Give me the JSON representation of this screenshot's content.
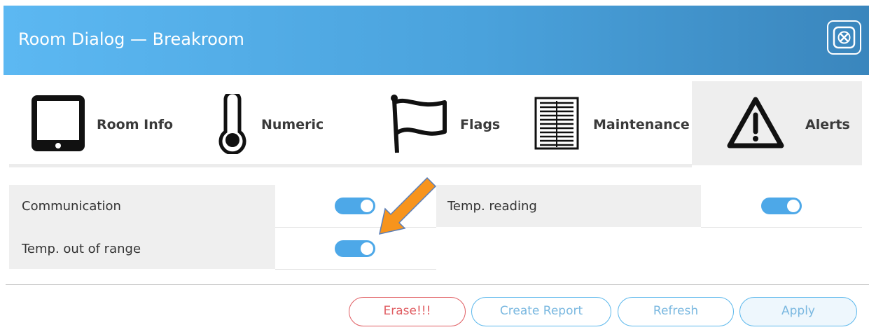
{
  "dialog": {
    "title": "Room Dialog — Breakroom",
    "close_icon": "close-x-icon"
  },
  "tabs": [
    {
      "label": "Room Info",
      "icon": "tablet-icon",
      "active": false
    },
    {
      "label": "Numeric",
      "icon": "thermometer-icon",
      "active": false
    },
    {
      "label": "Flags",
      "icon": "flag-icon",
      "active": false
    },
    {
      "label": "Maintenance",
      "icon": "list-document-icon",
      "active": false
    },
    {
      "label": "Alerts",
      "icon": "warning-triangle-icon",
      "active": true
    }
  ],
  "alerts": {
    "items": [
      {
        "label": "Communication",
        "enabled": true
      },
      {
        "label": "Temp. reading",
        "enabled": true
      },
      {
        "label": "Temp. out of range",
        "enabled": true
      }
    ]
  },
  "buttons": {
    "erase": "Erase!!!",
    "create_report": "Create Report",
    "refresh": "Refresh",
    "apply": "Apply"
  },
  "colors": {
    "title_gradient_start": "#5cb8f2",
    "title_gradient_end": "#3a86bd",
    "toggle_on": "#4da8e8",
    "erase_red": "#e05d62",
    "annotation_arrow": "#f7941d"
  }
}
